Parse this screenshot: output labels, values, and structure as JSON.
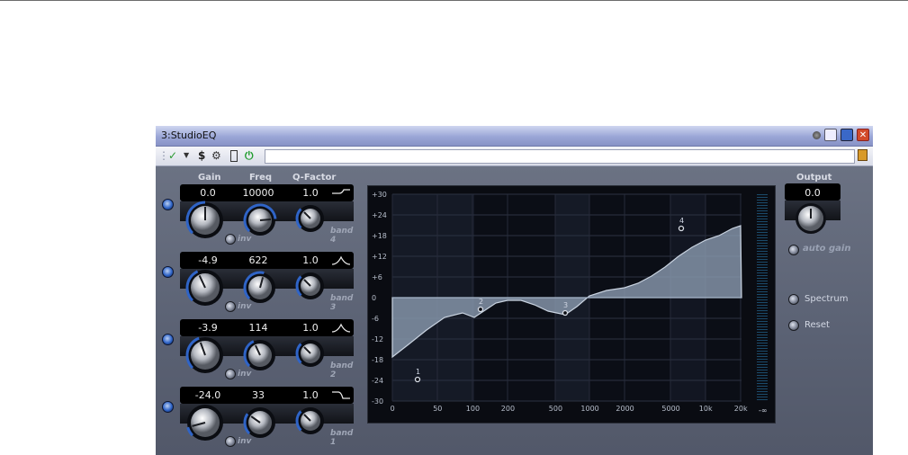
{
  "window": {
    "title": "3:StudioEQ"
  },
  "columns": {
    "gain": "Gain",
    "freq": "Freq",
    "q": "Q-Factor"
  },
  "bands": [
    {
      "gain": "0.0",
      "freq": "10000",
      "q": "1.0",
      "label": "band 4",
      "inv": "inv"
    },
    {
      "gain": "-4.9",
      "freq": "622",
      "q": "1.0",
      "label": "band 3",
      "inv": "inv"
    },
    {
      "gain": "-3.9",
      "freq": "114",
      "q": "1.0",
      "label": "band 2",
      "inv": "inv"
    },
    {
      "gain": "-24.0",
      "freq": "33",
      "q": "1.0",
      "label": "band 1",
      "inv": "inv"
    }
  ],
  "graph": {
    "y_labels": [
      "+30",
      "+24",
      "+18",
      "+12",
      "+6",
      "0",
      "-6",
      "-12",
      "-18",
      "-24",
      "-30"
    ],
    "x_labels": [
      "0",
      "50",
      "100",
      "200",
      "500",
      "1000",
      "2000",
      "5000",
      "10k",
      "20k"
    ],
    "points": [
      "1",
      "2",
      "3",
      "4"
    ],
    "meter_floor": "-∞"
  },
  "output": {
    "label": "Output",
    "value": "0.0",
    "auto_gain": "auto gain"
  },
  "buttons": {
    "spectrum": "Spectrum",
    "reset": "Reset"
  },
  "colors": {
    "accent": "#2f64c7",
    "curve_fill": "#8b9bb0"
  }
}
